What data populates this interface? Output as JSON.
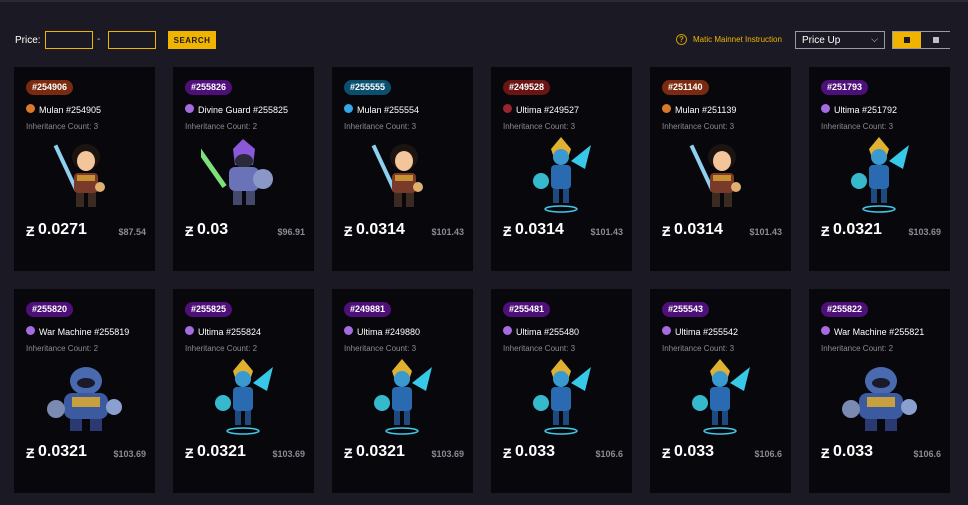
{
  "toolbar": {
    "price_label": "Price:",
    "price_min_value": "",
    "price_max_value": "",
    "dash": "-",
    "search_label": "SEARCH",
    "help_glyph": "?",
    "mainnet_label": "Matic Mainnet Instruction",
    "sort_selected": "Price Up"
  },
  "icons": {
    "coin": "Ƶ",
    "chevron": "⌵"
  },
  "colors": {
    "accent": "#f0b400",
    "badge_orange": "#7a2a10",
    "badge_purple": "#4e0f78",
    "badge_teal": "#0b4f6e",
    "badge_red": "#6b1414",
    "rarity_orange": "#d9792b",
    "rarity_purple": "#a46ce0",
    "rarity_blue": "#35a7e8",
    "rarity_red": "#9a2430"
  },
  "cards": [
    {
      "id": "#254906",
      "badge": "badge_orange",
      "rarity": "rarity_orange",
      "hero": "mulan",
      "name": "Mulan #254905",
      "inherit": "Inheritance Count:  3",
      "price": "0.0271",
      "usd": "$87.54"
    },
    {
      "id": "#255826",
      "badge": "badge_purple",
      "rarity": "rarity_purple",
      "hero": "guard",
      "name": "Divine Guard #255825",
      "inherit": "Inheritance Count:  2",
      "price": "0.03",
      "usd": "$96.91"
    },
    {
      "id": "#255555",
      "badge": "badge_teal",
      "rarity": "rarity_blue",
      "hero": "mulan",
      "name": "Mulan #255554",
      "inherit": "Inheritance Count:  3",
      "price": "0.0314",
      "usd": "$101.43"
    },
    {
      "id": "#249528",
      "badge": "badge_red",
      "rarity": "rarity_red",
      "hero": "ultima",
      "name": "Ultima #249527",
      "inherit": "Inheritance Count:  3",
      "price": "0.0314",
      "usd": "$101.43"
    },
    {
      "id": "#251140",
      "badge": "badge_orange",
      "rarity": "rarity_orange",
      "hero": "mulan",
      "name": "Mulan #251139",
      "inherit": "Inheritance Count:  3",
      "price": "0.0314",
      "usd": "$101.43"
    },
    {
      "id": "#251793",
      "badge": "badge_purple",
      "rarity": "rarity_purple",
      "hero": "ultima",
      "name": "Ultima #251792",
      "inherit": "Inheritance Count:  3",
      "price": "0.0321",
      "usd": "$103.69"
    },
    {
      "id": "#255820",
      "badge": "badge_purple",
      "rarity": "rarity_purple",
      "hero": "machine",
      "name": "War Machine #255819",
      "inherit": "Inheritance Count:  2",
      "price": "0.0321",
      "usd": "$103.69"
    },
    {
      "id": "#255825",
      "badge": "badge_purple",
      "rarity": "rarity_purple",
      "hero": "ultima",
      "name": "Ultima #255824",
      "inherit": "Inheritance Count:  2",
      "price": "0.0321",
      "usd": "$103.69"
    },
    {
      "id": "#249881",
      "badge": "badge_purple",
      "rarity": "rarity_purple",
      "hero": "ultima",
      "name": "Ultima #249880",
      "inherit": "Inheritance Count:  3",
      "price": "0.0321",
      "usd": "$103.69"
    },
    {
      "id": "#255481",
      "badge": "badge_purple",
      "rarity": "rarity_purple",
      "hero": "ultima",
      "name": "Ultima #255480",
      "inherit": "Inheritance Count:  3",
      "price": "0.033",
      "usd": "$106.6"
    },
    {
      "id": "#255543",
      "badge": "badge_purple",
      "rarity": "rarity_purple",
      "hero": "ultima",
      "name": "Ultima #255542",
      "inherit": "Inheritance Count:  3",
      "price": "0.033",
      "usd": "$106.6"
    },
    {
      "id": "#255822",
      "badge": "badge_purple",
      "rarity": "rarity_purple",
      "hero": "machine",
      "name": "War Machine #255821",
      "inherit": "Inheritance Count:  2",
      "price": "0.033",
      "usd": "$106.6"
    }
  ]
}
